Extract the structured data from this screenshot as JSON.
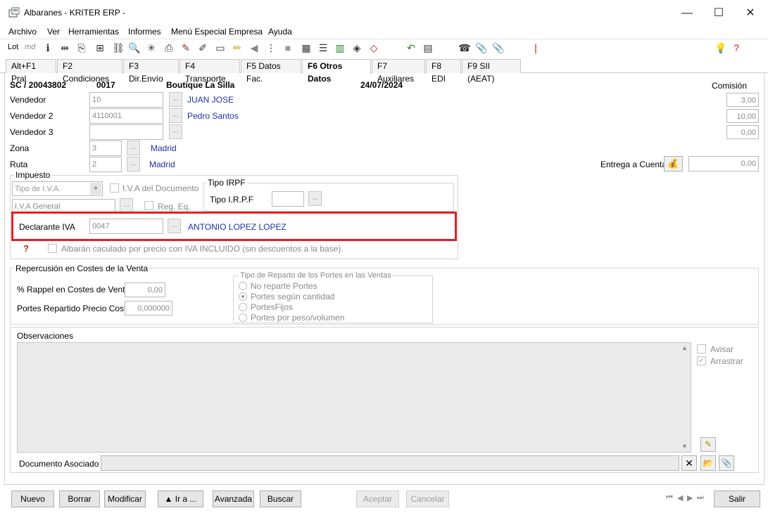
{
  "window": {
    "title": "Albaranes - KRITER ERP -",
    "minimize": "—",
    "maximize": "☐",
    "close": "✕"
  },
  "menu": [
    "Archivo",
    "Ver",
    "Herramientas",
    "Informes",
    "Menú Especial Empresa",
    "Ayuda"
  ],
  "toolbar": {
    "lot": "Lot",
    "md": "md"
  },
  "tabs": [
    "Alt+F1 Pral",
    "F2 Condiciones",
    "F3 Dir.Envío",
    "F4 Transporte",
    "F5 Datos Fac.",
    "F6 Otros Datos",
    "F7 Auxiliares",
    "F8 EDI",
    "F9 SII (AEAT)"
  ],
  "header": {
    "doc_ref": "SC / 20043802",
    "client_code": "0017",
    "client_name": "Boutique La Silla",
    "date": "24/07/2024",
    "comision_label": "Comisión"
  },
  "vendedor": {
    "label": "Vendedor",
    "code": "10",
    "name": "JUAN JOSE",
    "comision": "3,00"
  },
  "vendedor2": {
    "label": "Vendedor 2",
    "code": "4110001",
    "name": "Pedro Santos",
    "comision": "10,00"
  },
  "vendedor3": {
    "label": "Vendedor 3",
    "code": "",
    "comision": "0,00"
  },
  "zona": {
    "label": "Zona",
    "code": "3",
    "name": "Madrid"
  },
  "ruta": {
    "label": "Ruta",
    "code": "2",
    "name": "Madrid"
  },
  "entrega": {
    "label": "Entrega a Cuenta",
    "value": "0,00"
  },
  "impuesto": {
    "legend": "Impuesto",
    "tipo_iva": "Tipo de I.V.A.",
    "iva_documento": "I.V.A del Documento",
    "iva_general": "I.V.A General",
    "reg_eq": "Reg. Eq.",
    "irpf_legend": "Tipo IRPF",
    "irpf_label": "Tipo I.R.P.F",
    "irpf_value": "",
    "declarante_label": "Declarante IVA",
    "declarante_code": "0047",
    "declarante_name": "ANTONIO LOPEZ LOPEZ",
    "iva_incluido": "Albarán caculado por precio con IVA INCLUIDO (sin descuentos a la base)."
  },
  "repercusion": {
    "legend": "Repercusión en Costes de la Venta",
    "rappel_label": "% Rappel en Costes de Venta",
    "rappel_value": "0,00",
    "portes_label": "Portes Repartido Precio Coste",
    "portes_value": "0,000000",
    "reparto_legend": "Tipo de Reparto de los Portes en las Ventas",
    "reparto_options": [
      "No reparte Portes",
      "Portes según cantidad",
      "PortesFijos",
      "Portes por peso/volumen"
    ],
    "reparto_selected": 1
  },
  "observaciones": {
    "label": "Observaciones",
    "text": "",
    "avisar": "Avisar",
    "arrastrar": "Arrastrar",
    "documento_label": "Documento Asociado",
    "documento_value": ""
  },
  "buttons": {
    "nuevo": "Nuevo",
    "borrar": "Borrar",
    "modificar": "Modificar",
    "ira": "▲ Ir a ...",
    "avanzada": "Avanzada",
    "buscar": "Buscar",
    "aceptar": "Aceptar",
    "cancelar": "Cancelar",
    "salir": "Salir"
  },
  "colors": {
    "highlight": "#e11f26",
    "link_blue": "#1d2fa8"
  }
}
